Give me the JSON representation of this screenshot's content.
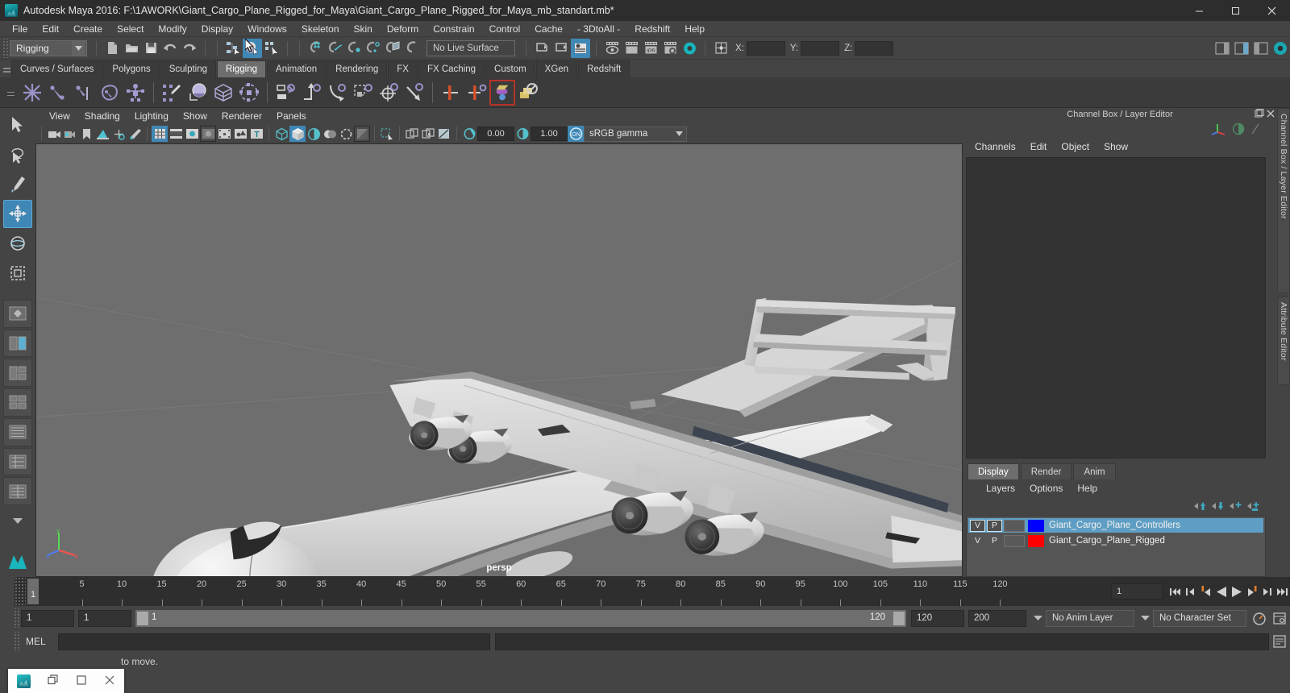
{
  "window": {
    "title": "Autodesk Maya 2016: F:\\1AWORK\\Giant_Cargo_Plane_Rigged_for_Maya\\Giant_Cargo_Plane_Rigged_for_Maya_mb_standart.mb*",
    "icon": "maya-app-icon",
    "controls": {
      "minimize": "minimize-icon",
      "maximize": "maximize-icon",
      "close": "close-icon"
    }
  },
  "menubar": {
    "items": [
      "File",
      "Edit",
      "Create",
      "Select",
      "Modify",
      "Display",
      "Windows",
      "Skeleton",
      "Skin",
      "Deform",
      "Constrain",
      "Control",
      "Cache",
      "- 3DtoAll -",
      "Redshift",
      "Help"
    ]
  },
  "status_line": {
    "menu_set": "Rigging",
    "live_surface": "No Live Surface",
    "coord_labels": [
      "X:",
      "Y:",
      "Z:"
    ],
    "coord_values": [
      "",
      "",
      ""
    ],
    "icons": [
      "new-scene-icon",
      "open-scene-icon",
      "save-scene-icon",
      "undo-icon",
      "redo-icon",
      "select-by-hierarchy-icon",
      "select-by-object-icon",
      "select-by-component-icon",
      "snap-to-grid-icon",
      "snap-to-curve-icon",
      "snap-to-point-icon",
      "snap-to-projected-center-icon",
      "snap-to-view-planes-icon",
      "make-live-icon",
      "open-outliner-icon",
      "open-hypergraph-icon",
      "open-attribute-editor-icon",
      "render-current-frame-icon",
      "render-sequence-icon",
      "ipr-render-icon",
      "render-settings-icon",
      "hypershade-icon",
      "absolute-transform-icon"
    ]
  },
  "shelf": {
    "tabs": [
      "Curves / Surfaces",
      "Polygons",
      "Sculpting",
      "Rigging",
      "Animation",
      "Rendering",
      "FX",
      "FX Caching",
      "Custom",
      "XGen",
      "Redshift"
    ],
    "selected_tab": "Rigging",
    "buttons": [
      "create-joint-icon",
      "create-ik-handle-icon",
      "create-ik-spline-handle-icon",
      "insert-joint-icon",
      "quick-rig-icon",
      "paint-skin-weights-icon",
      "smooth-bind-icon",
      "lattice-deformer-icon",
      "cluster-deformer-icon",
      "parent-constraint-icon",
      "point-constraint-icon",
      "orient-constraint-icon",
      "scale-constraint-icon",
      "aim-constraint-icon",
      "pole-vector-constraint-icon",
      "mirror-joint-icon",
      "mirror-skin-weights-icon",
      "transfer-skin-weights-icon",
      "disable-deformer-icon"
    ]
  },
  "toolbox": {
    "tools": [
      "select-tool",
      "lasso-select-tool",
      "paint-select-tool",
      "move-tool",
      "rotate-tool",
      "scale-tool",
      "last-tool",
      "layout-single-icon",
      "layout-two-pane-icon",
      "layout-three-pane-icon",
      "layout-four-pane-icon",
      "layout-persp-outliner-icon",
      "layout-hypergraph-icon",
      "layout-custom-icon",
      "layout-more-icon",
      "maya-shelf-icon"
    ],
    "selected_tool": "move-tool"
  },
  "viewport": {
    "menus": [
      "View",
      "Shading",
      "Lighting",
      "Show",
      "Renderer",
      "Panels"
    ],
    "camera_label": "persp",
    "toolbar": {
      "exposure": "0.00",
      "gamma": "1.00",
      "view_transform": "sRGB gamma",
      "icons": [
        "select-camera-icon",
        "camera-attributes-icon",
        "bookmark-icon",
        "image-plane-icon",
        "two-d-pan-zoom-icon",
        "grease-pencil-icon",
        "grid-toggle-icon",
        "film-gate-icon",
        "resolution-gate-icon",
        "gate-mask-icon",
        "xray-joints-icon",
        "xray-active-components-icon",
        "texture-toggle-icon",
        "wireframe-shading-icon",
        "smooth-shaded-icon",
        "smooth-shade-all-icon",
        "use-all-lights-icon",
        "shadows-icon",
        "screen-space-ao-icon",
        "motion-blur-icon",
        "multisample-icon",
        "isolate-select-icon",
        "xray-icon",
        "xray-joints-2-icon",
        "view-uv-icon",
        "exposure-icon",
        "gamma-icon",
        "color-management-on-icon"
      ]
    }
  },
  "right_panel": {
    "title": "Channel Box / Layer Editor",
    "window_icons": [
      "undock-icon",
      "close-panel-icon"
    ],
    "channel_menus": [
      "Channels",
      "Edit",
      "Object",
      "Show"
    ],
    "layer_tabs": [
      "Display",
      "Render",
      "Anim"
    ],
    "selected_layer_tab": "Display",
    "layer_menus": [
      "Layers",
      "Options",
      "Help"
    ],
    "layer_tool_icons": [
      "move-layer-up-icon",
      "move-layer-down-icon",
      "new-layer-icon",
      "new-layer-from-selected-icon"
    ],
    "layers": [
      {
        "v": "V",
        "p": "P",
        "color": "#0000ff",
        "name": "Giant_Cargo_Plane_Controllers",
        "selected": true
      },
      {
        "v": "V",
        "p": "P",
        "color": "#ff0000",
        "name": "Giant_Cargo_Plane_Rigged",
        "selected": false
      }
    ],
    "side_tabs": [
      "Channel Box / Layer Editor",
      "Attribute Editor"
    ]
  },
  "timeline": {
    "ticks": [
      5,
      10,
      15,
      20,
      25,
      30,
      35,
      40,
      45,
      50,
      55,
      60,
      65,
      70,
      75,
      80,
      85,
      90,
      95,
      100,
      105,
      110,
      115,
      120
    ],
    "current_frame": "1",
    "frame_field": "1",
    "playback_icons": [
      "go-to-start-icon",
      "step-back-frame-icon",
      "step-back-key-icon",
      "play-backwards-icon",
      "play-forwards-icon",
      "step-forward-key-icon",
      "step-forward-frame-icon",
      "go-to-end-icon"
    ]
  },
  "range_slider": {
    "anim_start": "1",
    "range_start": "1",
    "slider_start_label": "1",
    "slider_end_label": "120",
    "range_end": "120",
    "anim_end": "200",
    "anim_layer": "No Anim Layer",
    "character_set": "No Character Set",
    "auto_key_icon": "auto-keyframe-icon",
    "anim_prefs_icon": "animation-preferences-icon"
  },
  "command_line": {
    "language": "MEL",
    "input": "",
    "output": "",
    "script_editor_icon": "script-editor-icon"
  },
  "help_line": {
    "text": "to move."
  },
  "taskbar_popup": {
    "icons": [
      "maya-app-icon",
      "restore-window-icon",
      "maximize-window-icon",
      "close-window-icon"
    ]
  },
  "colors": {
    "accent_blue": "#3f87b5",
    "selection_blue": "#5f9ec4",
    "panel_bg": "#444444",
    "viewport_bg": "#6e6e6e",
    "plane_body": "#cfcfcf"
  }
}
